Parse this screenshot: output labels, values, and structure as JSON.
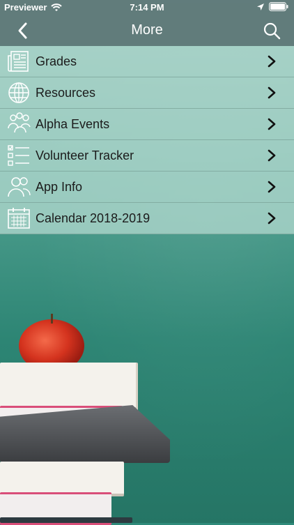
{
  "status": {
    "carrier": "Previewer",
    "time": "7:14 PM"
  },
  "nav": {
    "title": "More",
    "back_icon": "chevron-left-icon",
    "search_icon": "search-icon"
  },
  "menu": {
    "items": [
      {
        "label": "Grades",
        "icon": "newspaper-icon"
      },
      {
        "label": "Resources",
        "icon": "globe-icon"
      },
      {
        "label": "Alpha Events",
        "icon": "people-icon"
      },
      {
        "label": "Volunteer Tracker",
        "icon": "checklist-icon"
      },
      {
        "label": "App Info",
        "icon": "users-icon"
      },
      {
        "label": "Calendar 2018-2019",
        "icon": "calendar-icon"
      }
    ]
  },
  "colors": {
    "bar": "#5f7878",
    "menu_bg": "#afd7cd",
    "chalkboard": "#2f8a7a"
  }
}
